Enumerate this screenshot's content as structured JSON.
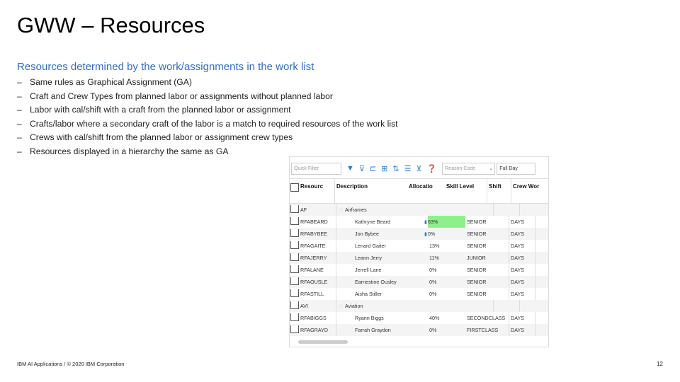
{
  "title": "GWW – Resources",
  "subtitle": "Resources determined by the work/assignments in the work list",
  "bullets": [
    "Same  rules as Graphical Assignment (GA)",
    "Craft and Crew Types from planned labor or assignments without planned labor",
    "Labor with cal/shift with a craft from the planned labor or assignment",
    "Crafts/labor where a secondary craft of the labor is a match to required resources of the work list",
    "Crews with cal/shift from the planned labor or assignment crew types",
    "Resources displayed in a hierarchy the same as GA"
  ],
  "dash": "–",
  "footer": "IBM AI Applications / © 2020 IBM Corporation",
  "page_number": "12",
  "app": {
    "quick_filter_placeholder": "Quick Filter",
    "reason_code_placeholder": "Reason Code",
    "full_day": "Full Day",
    "columns": [
      "Resourc",
      "Description",
      "Allocatio",
      "Skill Level",
      "Shift",
      "Crew Wor"
    ],
    "rows": [
      {
        "resource": "AF",
        "description": "Airframes",
        "group": true
      },
      {
        "resource": "RFABEARD",
        "description": "Kathryne Beard",
        "allocation": "63%",
        "skill": "SENIOR",
        "shift": "DAYS",
        "icon": true,
        "highlight": true
      },
      {
        "resource": "RFABYBEE",
        "description": "Jon Bybee",
        "allocation": "0%",
        "skill": "SENIOR",
        "shift": "DAYS",
        "icon": true
      },
      {
        "resource": "RFAGAITE",
        "description": "Lenard Gaiter",
        "allocation": "13%",
        "skill": "SENIOR",
        "shift": "DAYS"
      },
      {
        "resource": "RFAJERRY",
        "description": "Leann Jerry",
        "allocation": "11%",
        "skill": "JUNIOR",
        "shift": "DAYS"
      },
      {
        "resource": "RFALANE",
        "description": "Jerrell Lane",
        "allocation": "0%",
        "skill": "SENIOR",
        "shift": "DAYS"
      },
      {
        "resource": "RFAOUSLE",
        "description": "Earnestine Ousley",
        "allocation": "0%",
        "skill": "SENIOR",
        "shift": "DAYS"
      },
      {
        "resource": "RFASTILL",
        "description": "Aisha Stiller",
        "allocation": "0%",
        "skill": "SENIOR",
        "shift": "DAYS"
      },
      {
        "resource": "AVI",
        "description": "Aviation",
        "group": true
      },
      {
        "resource": "RFABIGGS",
        "description": "Ryann Biggs",
        "allocation": "40%",
        "skill": "SECONDCLASS",
        "shift": "DAYS"
      },
      {
        "resource": "RFAGRAYD",
        "description": "Farrah Graydon",
        "allocation": "0%",
        "skill": "FIRSTCLASS",
        "shift": "DAYS"
      }
    ],
    "highlight_color": "#8ef08a"
  }
}
